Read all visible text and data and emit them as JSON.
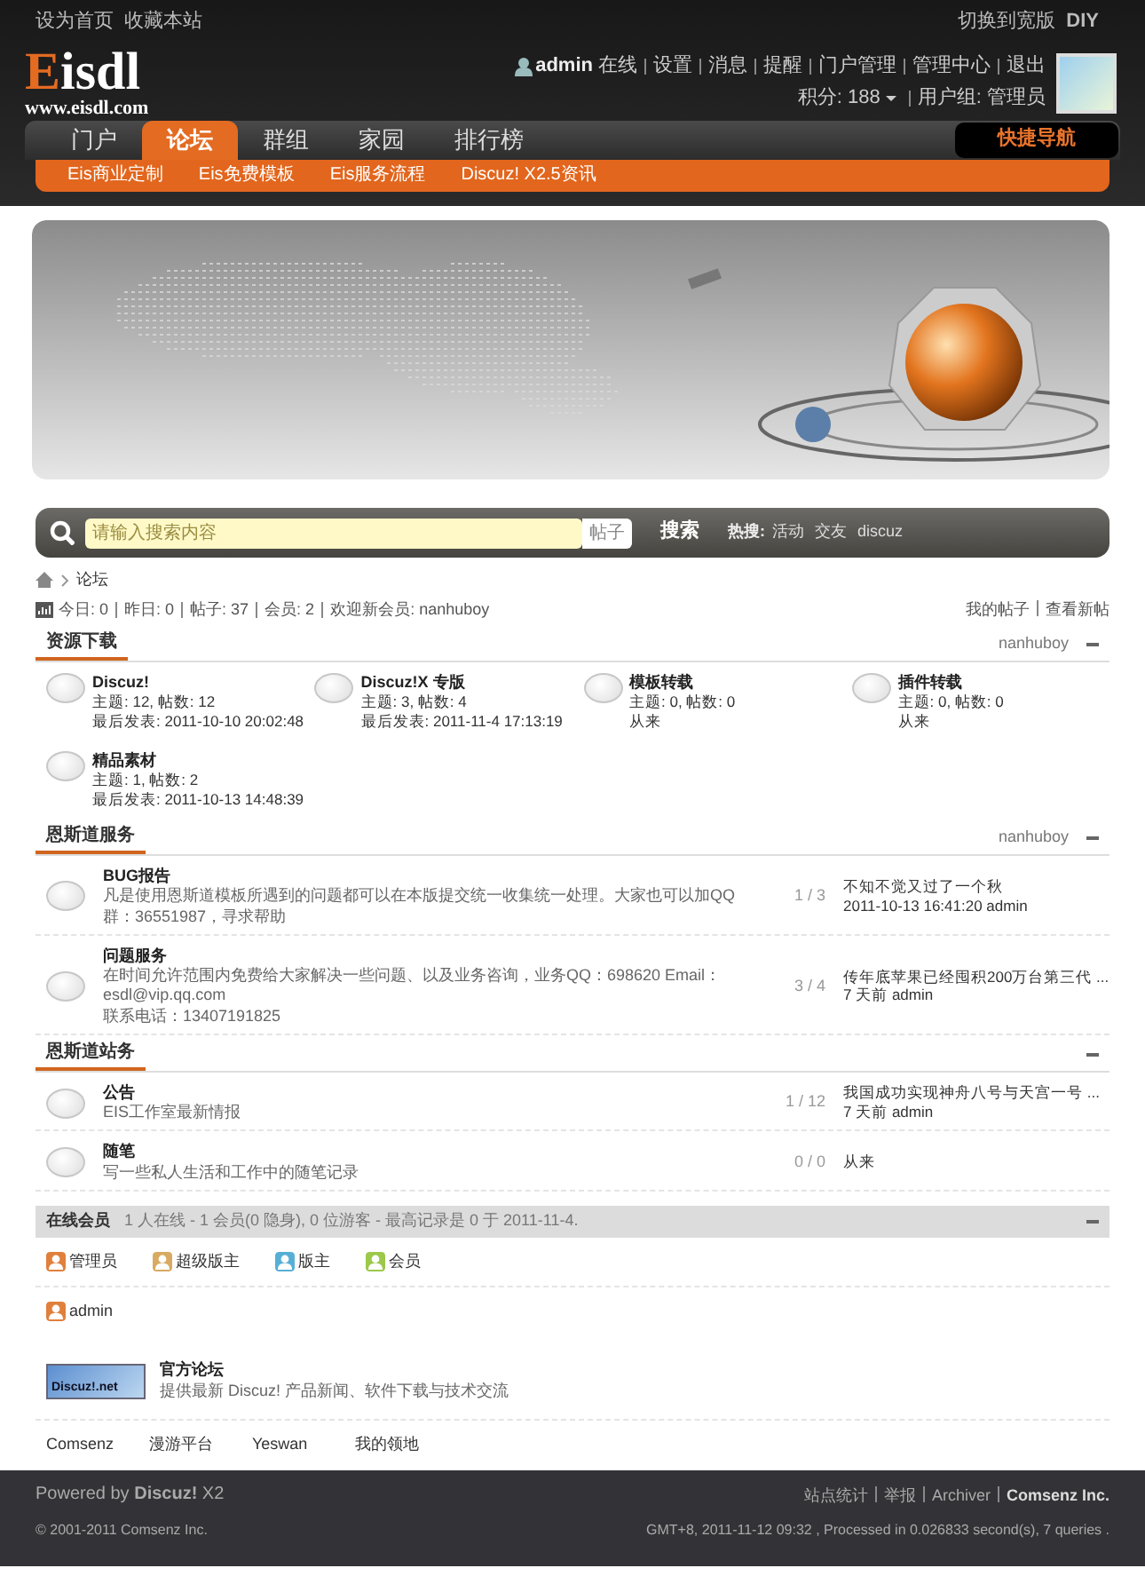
{
  "top_bar": {
    "left_links": [
      "设为首页",
      "收藏本站"
    ],
    "right_links": [
      "切换到宽版",
      "DIY"
    ]
  },
  "logo": {
    "name": "Eisdl",
    "url": "www.eisdl.com"
  },
  "user": {
    "name": "admin",
    "status": "在线",
    "links": [
      "设置",
      "消息",
      "提醒",
      "门户管理",
      "管理中心",
      "退出"
    ],
    "points": "积分: 188",
    "group": "用户组: 管理员"
  },
  "nav": {
    "tabs": [
      {
        "label": "门户",
        "selected": false
      },
      {
        "label": "论坛",
        "selected": true
      },
      {
        "label": "群组",
        "selected": false
      },
      {
        "label": "家园",
        "selected": false
      },
      {
        "label": "排行榜",
        "selected": false
      }
    ],
    "quick_nav": "快捷导航"
  },
  "subnav": [
    "Eis商业定制",
    "Eis免费模板",
    "Eis服务流程",
    "Discuz! X2.5资讯"
  ],
  "search": {
    "placeholder": "请输入搜索内容",
    "scope": "帖子",
    "button": "搜索",
    "hot_label": "热搜:",
    "hot": [
      "活动",
      "交友",
      "discuz"
    ]
  },
  "breadcrumb": [
    "论坛"
  ],
  "stats": [
    "今日: 0",
    "昨日: 0",
    "帖子: 37",
    "会员: 2",
    "欢迎新会员: nanhuboy"
  ],
  "stats_links": [
    "我的帖子",
    "查看新帖"
  ],
  "sections": [
    {
      "kind": "grid",
      "title": "资源下载",
      "moderator": "nanhuboy",
      "forums": [
        {
          "name": "Discuz!",
          "counts": "主题: 12, 帖数: 12",
          "last": "最后发表: 2011-10-10 20:02:48"
        },
        {
          "name": "Discuz!X 专版",
          "counts": "主题: 3, 帖数: 4",
          "last": "最后发表: 2011-11-4 17:13:19"
        },
        {
          "name": "模板转载",
          "counts": "主题: 0, 帖数: 0",
          "last": "从来"
        },
        {
          "name": "插件转载",
          "counts": "主题: 0, 帖数: 0",
          "last": "从来"
        },
        {
          "name": "精品素材",
          "counts": "主题: 1, 帖数: 2",
          "last": "最后发表: 2011-10-13 14:48:39"
        }
      ]
    },
    {
      "kind": "list",
      "title": "恩斯道服务",
      "moderator": "nanhuboy",
      "forums": [
        {
          "name": "BUG报告",
          "description": [
            "凡是使用恩斯道模板所遇到的问题都可以在本版提交统一收集统一处理。大家也可以加QQ群：36551987，寻求帮助"
          ],
          "counts": "1 / 3",
          "last_title": "不知不觉又过了一个秋",
          "last_meta": "2011-10-13 16:41:20 admin"
        },
        {
          "name": "问题服务",
          "description": [
            "在时间允许范围内免费给大家解决一些问题、以及业务咨询，业务QQ：698620 Email：esdl@vip.qq.com",
            "联系电话：13407191825"
          ],
          "counts": "3 / 4",
          "last_title": "传年底苹果已经囤积200万台第三代 ...",
          "last_meta": "7 天前 admin"
        }
      ]
    },
    {
      "kind": "list",
      "title": "恩斯道站务",
      "forums": [
        {
          "name": "公告",
          "description": [
            "EIS工作室最新情报"
          ],
          "counts": "1 / 12",
          "last_title": "我国成功实现神舟八号与天宫一号 ...",
          "last_meta": "7 天前 admin"
        },
        {
          "name": "随笔",
          "description": [
            "写一些私人生活和工作中的随笔记录"
          ],
          "counts": "0 / 0",
          "last_title": "从来"
        }
      ]
    }
  ],
  "online": {
    "title": "在线会员",
    "summary": "1 人在线 - 1 会员(0 隐身), 0 位游客 - 最高记录是 0 于 2011-11-4.",
    "legend": [
      {
        "label": "管理员",
        "color": "#e0803c"
      },
      {
        "label": "超级版主",
        "color": "#d8aa62"
      },
      {
        "label": "版主",
        "color": "#58afd6"
      },
      {
        "label": "会员",
        "color": "#9cc84c"
      }
    ],
    "members": [
      {
        "name": "admin",
        "color": "#e0803c"
      }
    ]
  },
  "partners": {
    "featured": {
      "logo": "Discuz!.net",
      "title": "官方论坛",
      "description": "提供最新 Discuz! 产品新闻、软件下载与技术交流"
    },
    "links": [
      "Comsenz",
      "漫游平台",
      "Yeswan",
      "我的领地"
    ]
  },
  "footer": {
    "powered": "Powered by **Discuz!** X2",
    "copyright": "© 2001-2011 Comsenz Inc.",
    "links": [
      {
        "label": "站点统计",
        "bold": false
      },
      {
        "label": "举报",
        "bold": false
      },
      {
        "label": "Archiver",
        "bold": false
      },
      {
        "label": "Comsenz Inc.",
        "bold": true
      }
    ],
    "info": "GMT+8, 2011-11-12 09:32 , Processed in 0.026833 second(s), 7 queries ."
  }
}
